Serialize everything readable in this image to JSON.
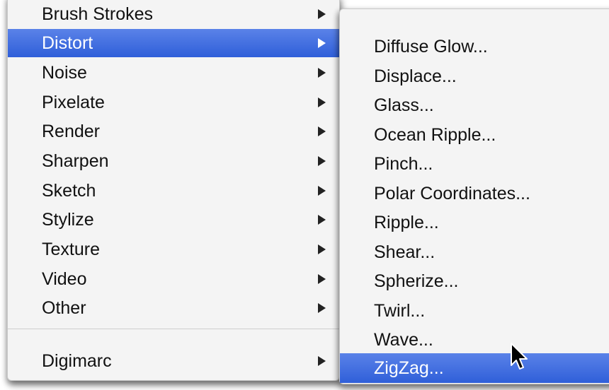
{
  "main_menu": {
    "items": [
      {
        "label": "Brush Strokes",
        "has_submenu": true
      },
      {
        "label": "Distort",
        "has_submenu": true,
        "highlighted": true
      },
      {
        "label": "Noise",
        "has_submenu": true
      },
      {
        "label": "Pixelate",
        "has_submenu": true
      },
      {
        "label": "Render",
        "has_submenu": true
      },
      {
        "label": "Sharpen",
        "has_submenu": true
      },
      {
        "label": "Sketch",
        "has_submenu": true
      },
      {
        "label": "Stylize",
        "has_submenu": true
      },
      {
        "label": "Texture",
        "has_submenu": true
      },
      {
        "label": "Video",
        "has_submenu": true
      },
      {
        "label": "Other",
        "has_submenu": true
      },
      {
        "label": "Digimarc",
        "has_submenu": true
      }
    ]
  },
  "submenu": {
    "items": [
      {
        "label": "Diffuse Glow..."
      },
      {
        "label": "Displace..."
      },
      {
        "label": "Glass..."
      },
      {
        "label": "Ocean Ripple..."
      },
      {
        "label": "Pinch..."
      },
      {
        "label": "Polar Coordinates..."
      },
      {
        "label": "Ripple..."
      },
      {
        "label": "Shear..."
      },
      {
        "label": "Spherize..."
      },
      {
        "label": "Twirl..."
      },
      {
        "label": "Wave..."
      },
      {
        "label": "ZigZag...",
        "highlighted": true
      }
    ]
  },
  "colors": {
    "highlight": "#3a68dd",
    "menu_background": "#f4f4f4",
    "text": "#111111",
    "highlight_text": "#ffffff"
  },
  "icons": {
    "submenu_arrow": "triangle-right-icon",
    "cursor": "mouse-pointer-icon"
  }
}
